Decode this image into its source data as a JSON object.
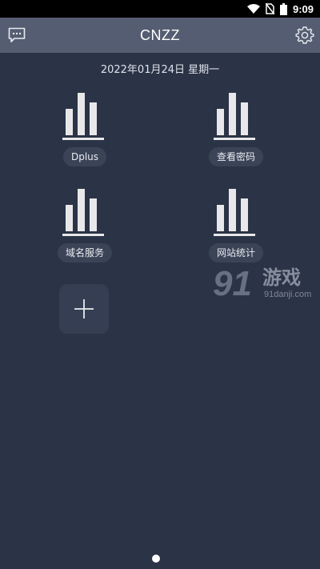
{
  "status_bar": {
    "time": "9:09"
  },
  "app_bar": {
    "title": "CNZZ"
  },
  "date": "2022年01月24日 星期一",
  "tiles": [
    {
      "label": "Dplus",
      "icon": "bar-chart-icon"
    },
    {
      "label": "查看密码",
      "icon": "bar-chart-icon"
    },
    {
      "label": "域名服务",
      "icon": "bar-chart-icon"
    },
    {
      "label": "网站统计",
      "icon": "bar-chart-icon"
    }
  ],
  "add_button": {
    "icon": "plus-icon"
  },
  "watermark": {
    "digits": "91",
    "text": "游戏",
    "url": "91danji.com"
  },
  "colors": {
    "background": "#2b3346",
    "app_bar": "#555d72",
    "tile_label_bg": "#3b4457",
    "icon_light": "#e8e8ea"
  }
}
